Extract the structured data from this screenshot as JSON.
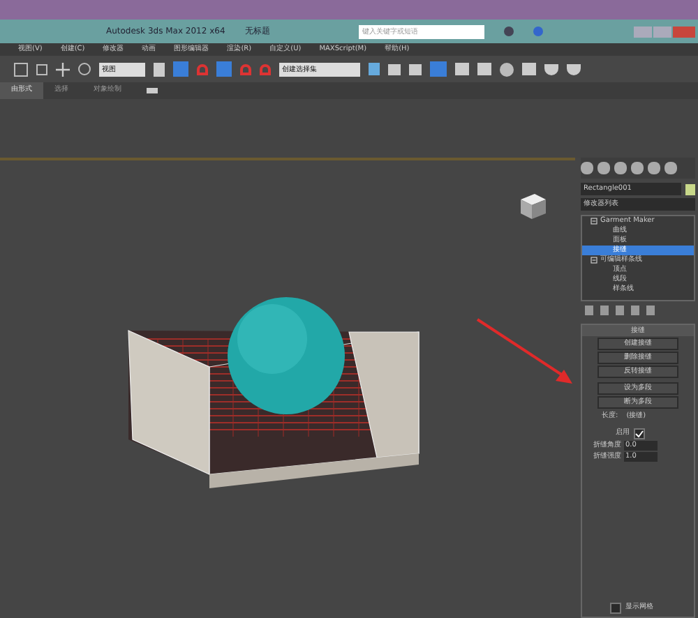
{
  "window": {
    "title": "Autodesk 3ds Max  2012 x64",
    "document": "无标题"
  },
  "search": {
    "placeholder": "键入关键字或短语"
  },
  "menu": [
    "视图(V)",
    "创建(C)",
    "修改器",
    "动画",
    "图形编辑器",
    "渲染(R)",
    "自定义(U)",
    "MAXScript(M)",
    "帮助(H)"
  ],
  "toolbar": {
    "reference_dropdown": "视图",
    "selection_set_dropdown": "创建选择集"
  },
  "ribbon_tabs": [
    {
      "label": "由形式",
      "selected": true
    },
    {
      "label": "选择",
      "selected": false
    },
    {
      "label": "对象绘制",
      "selected": false
    }
  ],
  "command_panel": {
    "object_name": "Rectangle001",
    "modifier_list": "修改器列表",
    "stack": [
      {
        "label": "Garment Maker",
        "selected": false,
        "children": [
          {
            "label": "曲线",
            "selected": false
          },
          {
            "label": "面板",
            "selected": false
          },
          {
            "label": "接缝",
            "selected": true
          }
        ]
      },
      {
        "label": "可编辑样条线",
        "selected": false,
        "children": [
          {
            "label": "顶点",
            "selected": false
          },
          {
            "label": "线段",
            "selected": false
          },
          {
            "label": "样条线",
            "selected": false
          }
        ]
      }
    ],
    "rollout_title": "接缝",
    "buttons": [
      "创建接缝",
      "删除接缝",
      "反转接缝",
      "设为多段",
      "断为多段"
    ],
    "length_label": "长度:",
    "length_value": "(接缝)",
    "enable": {
      "label": "启用",
      "checked": true
    },
    "spinners": [
      {
        "label": "折缝角度",
        "value": "0.0"
      },
      {
        "label": "折缝强度",
        "value": "1.0"
      }
    ],
    "show_mesh": {
      "label": "显示网格",
      "checked": false
    }
  }
}
